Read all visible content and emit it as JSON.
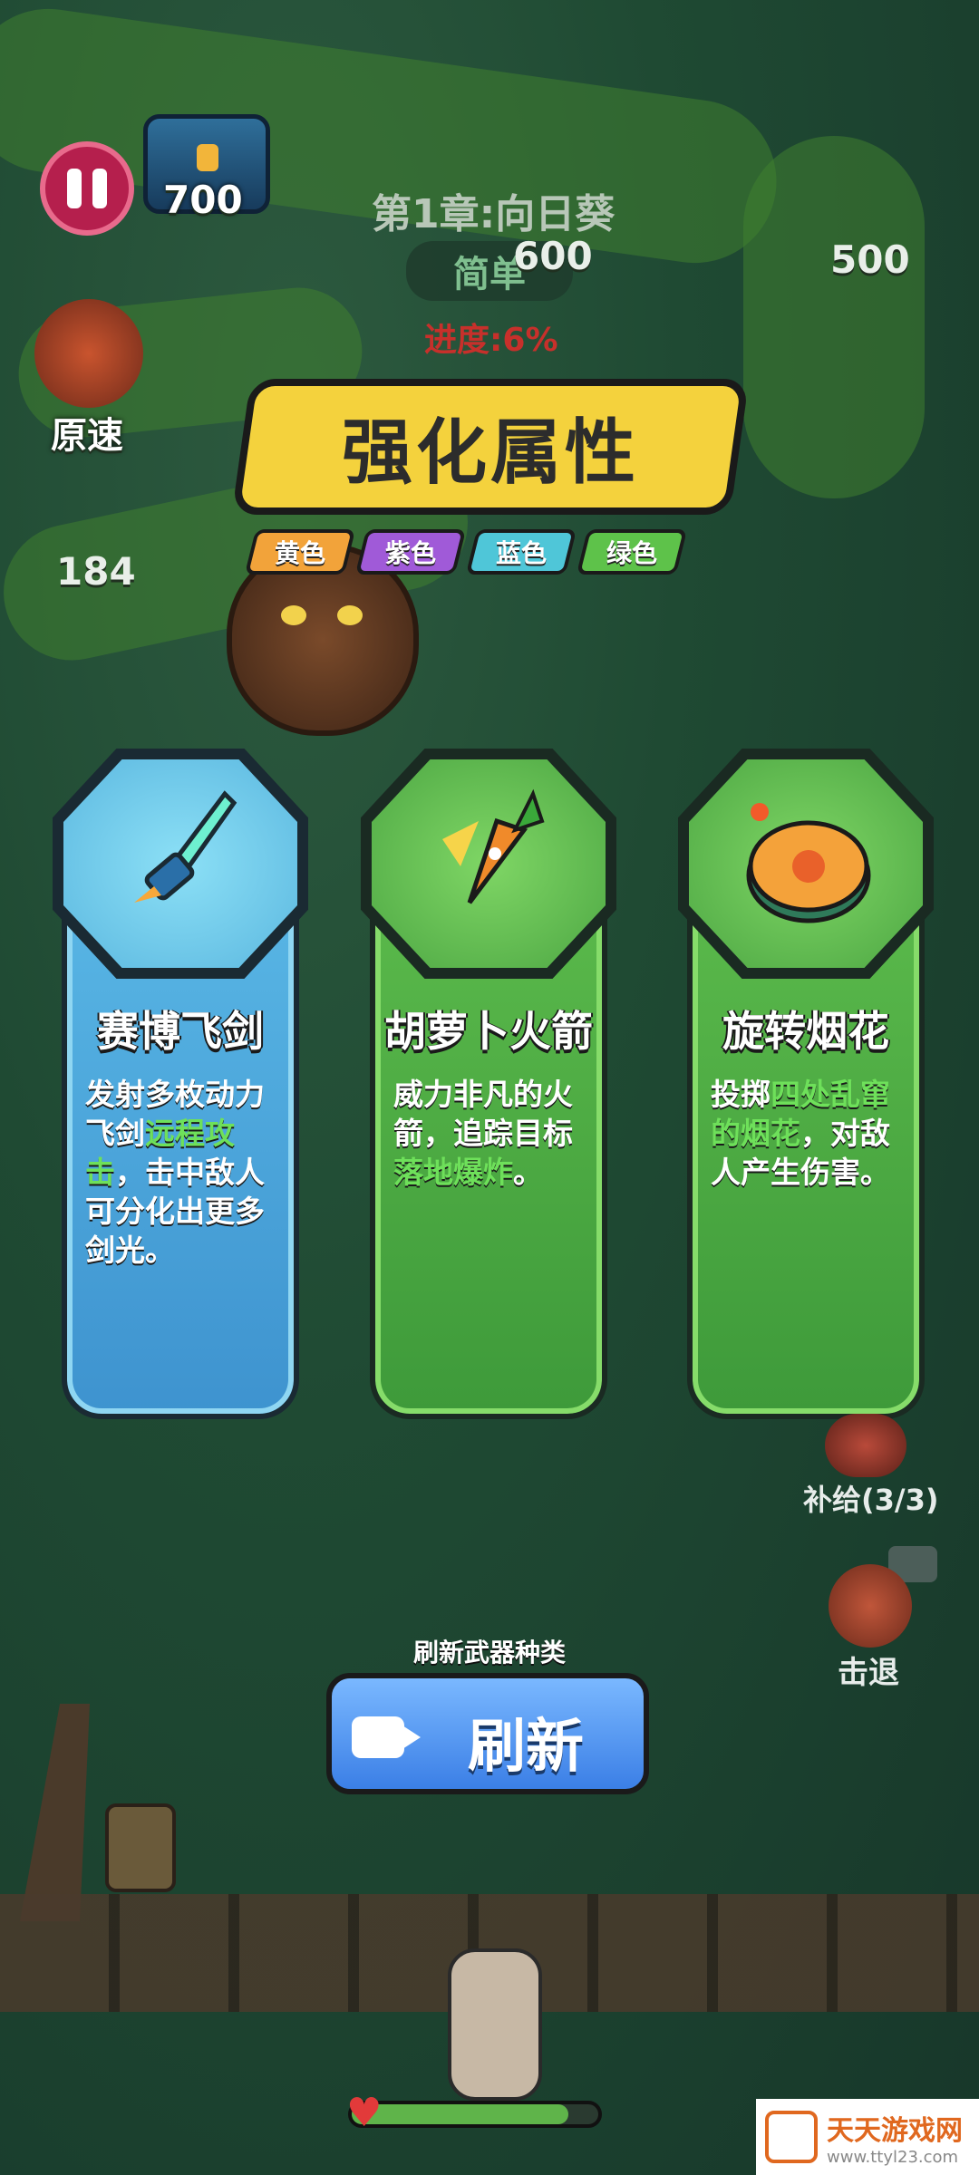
{
  "top": {
    "coins": "700",
    "chapter": "第1章:向日葵",
    "difficulty": "简单",
    "progress": "进度:6%"
  },
  "field_numbers": {
    "n1": "600",
    "n2": "500",
    "n3": "184"
  },
  "speed": {
    "label": "原速",
    "icon": "speed-icon"
  },
  "banner": {
    "title": "强化属性"
  },
  "tags": [
    {
      "label": "黄色",
      "color": "#f2a33a"
    },
    {
      "label": "紫色",
      "color": "#a05ad8"
    },
    {
      "label": "蓝色",
      "color": "#4fc6d8"
    },
    {
      "label": "绿色",
      "color": "#5ec24a"
    }
  ],
  "cards": [
    {
      "name": "赛博飞剑",
      "desc_parts": [
        "发射多枚动力飞剑",
        "远程攻击",
        "，击中敌人可分化出更多剑光。"
      ],
      "icon": "cyber-sword-icon",
      "theme": "#59b7e4"
    },
    {
      "name": "胡萝卜火箭",
      "desc_parts": [
        "威力非凡的火箭，追踪目标",
        "落地爆炸",
        "。"
      ],
      "icon": "carrot-rocket-icon",
      "theme": "#57b94a"
    },
    {
      "name": "旋转烟花",
      "desc_parts": [
        "投掷",
        "四处乱窜的烟花",
        "，对敌人产生伤害。"
      ],
      "icon": "spinning-firework-icon",
      "theme": "#57b94a"
    }
  ],
  "side": {
    "supply": "补给(3/3)",
    "knockback": "击退"
  },
  "refresh": {
    "hint": "刷新武器种类",
    "label": "刷新"
  },
  "player": {
    "hp_fraction": 0.88
  },
  "watermark": {
    "title": "天天游戏网",
    "url": "www.ttyl23.com"
  }
}
